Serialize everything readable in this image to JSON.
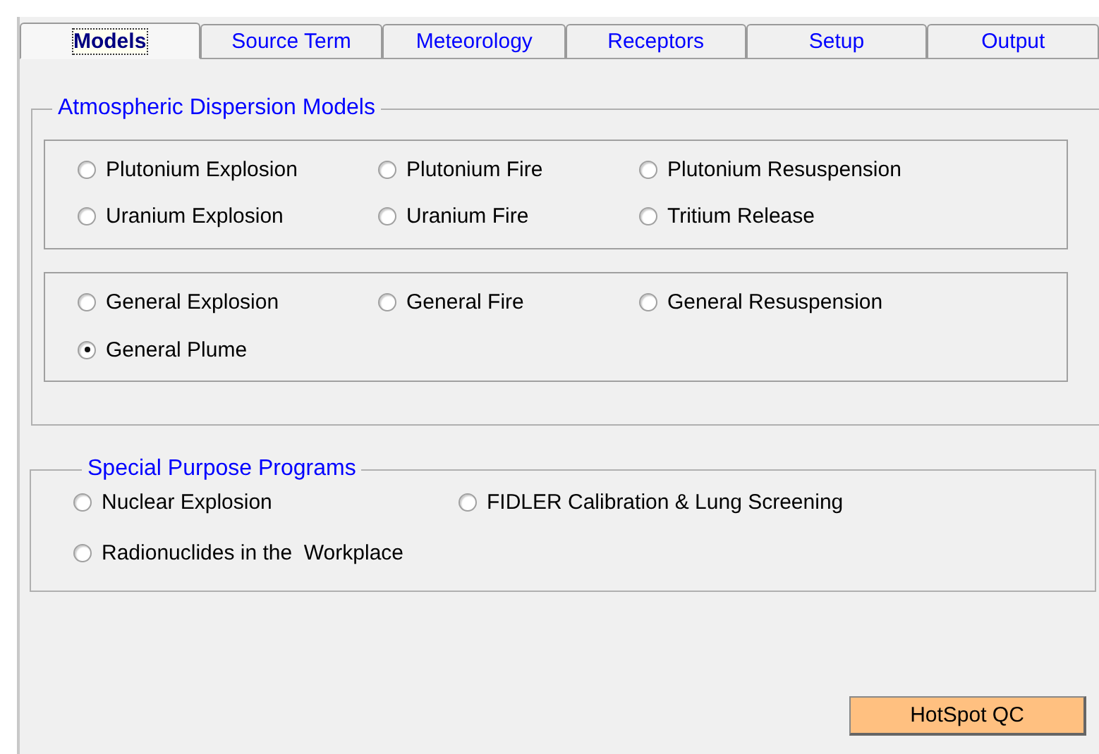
{
  "tabs": [
    {
      "label": "Models",
      "selected": true
    },
    {
      "label": "Source Term",
      "selected": false
    },
    {
      "label": "Meteorology",
      "selected": false
    },
    {
      "label": "Receptors",
      "selected": false
    },
    {
      "label": "Setup",
      "selected": false
    },
    {
      "label": "Output",
      "selected": false
    }
  ],
  "atmospheric": {
    "title": "Atmospheric Dispersion Models",
    "boxes": [
      {
        "options": [
          {
            "label": "Plutonium Explosion",
            "selected": false
          },
          {
            "label": "Plutonium Fire",
            "selected": false
          },
          {
            "label": "Plutonium Resuspension",
            "selected": false
          },
          {
            "label": "Uranium Explosion",
            "selected": false
          },
          {
            "label": "Uranium Fire",
            "selected": false
          },
          {
            "label": "Tritium Release",
            "selected": false
          }
        ]
      },
      {
        "options": [
          {
            "label": "General Explosion",
            "selected": false
          },
          {
            "label": "General Fire",
            "selected": false
          },
          {
            "label": "General Resuspension",
            "selected": false
          },
          {
            "label": "General Plume",
            "selected": true
          }
        ]
      }
    ]
  },
  "special": {
    "title": "Special Purpose Programs",
    "options": [
      {
        "label": "Nuclear Explosion",
        "selected": false
      },
      {
        "label": "FIDLER Calibration & Lung Screening",
        "selected": false
      },
      {
        "label": "Radionuclides in the  Workplace",
        "selected": false
      }
    ]
  },
  "button": {
    "label": "HotSpot QC"
  }
}
